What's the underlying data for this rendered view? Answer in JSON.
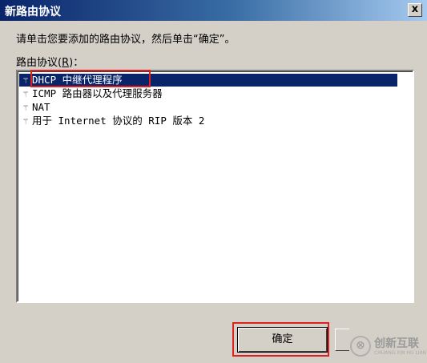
{
  "window": {
    "title": "新路由协议",
    "close_label": "x"
  },
  "dialog": {
    "instruction": "请单击您要添加的路由协议，然后单击“确定”。",
    "list_label_prefix": "路由协议(",
    "list_label_key": "R",
    "list_label_suffix": ")："
  },
  "protocols": {
    "items": [
      {
        "icon": "protocol-icon",
        "label": "DHCP 中继代理程序",
        "selected": true
      },
      {
        "icon": "protocol-icon",
        "label": "ICMP 路由器以及代理服务器",
        "selected": false
      },
      {
        "icon": "protocol-icon",
        "label": "NAT",
        "selected": false
      },
      {
        "icon": "protocol-icon",
        "label": "用于 Internet 协议的 RIP 版本 2",
        "selected": false
      }
    ]
  },
  "buttons": {
    "ok_label": "确定"
  },
  "watermark": {
    "text": "创新互联",
    "sub": "CHUANG XIN HU LIAN"
  },
  "colors": {
    "selection": "#0a246a",
    "annotation": "#e02020",
    "dialog_bg": "#d4d0c8"
  }
}
